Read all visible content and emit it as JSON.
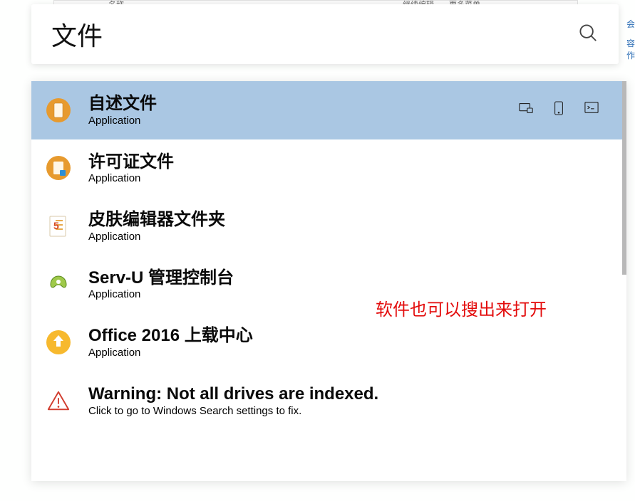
{
  "search": {
    "value": "文件"
  },
  "results": [
    {
      "title": "自述文件",
      "subtitle": "Application",
      "selected": true
    },
    {
      "title": "许可证文件",
      "subtitle": "Application",
      "selected": false
    },
    {
      "title": "皮肤编辑器文件夹",
      "subtitle": "Application",
      "selected": false
    },
    {
      "title": "Serv-U 管理控制台",
      "subtitle": "Application",
      "selected": false
    },
    {
      "title": "Office 2016 上载中心",
      "subtitle": "Application",
      "selected": false
    },
    {
      "title": "Warning: Not all drives are indexed.",
      "subtitle": "Click to go to Windows Search settings to fix.",
      "selected": false,
      "warning": true
    }
  ],
  "annotation": "软件也可以搜出来打开",
  "side_fragments": {
    "a": "会",
    "b": "容",
    "c": "作"
  },
  "bg_fragments": {
    "left": "名称",
    "right_a": "继续编辑",
    "right_b": "更多菜单"
  }
}
